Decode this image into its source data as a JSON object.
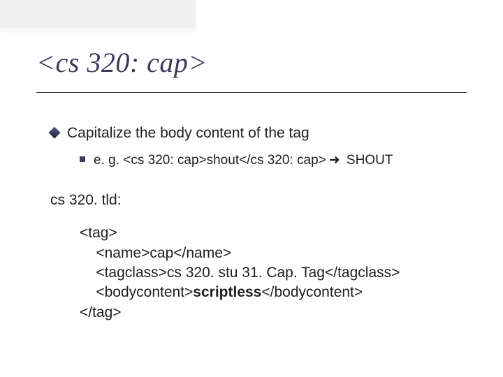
{
  "slide": {
    "title": "<cs 320: cap>",
    "bullet_main": "Capitalize the body content of the tag",
    "bullet_sub_prefix": "e. g. ",
    "bullet_sub_code": "<cs 320: cap>shout</cs 320: cap>",
    "bullet_sub_arrow": "➜",
    "bullet_sub_result": " SHOUT",
    "tld_label": "cs 320. tld:",
    "code": {
      "l1": "<tag>",
      "l2": "    <name>cap</name>",
      "l3": "    <tagclass>cs 320. stu 31. Cap. Tag</tagclass>",
      "l4a": "    <bodycontent>",
      "l4b": "scriptless",
      "l4c": "</bodycontent>",
      "l5": "</tag>"
    }
  }
}
